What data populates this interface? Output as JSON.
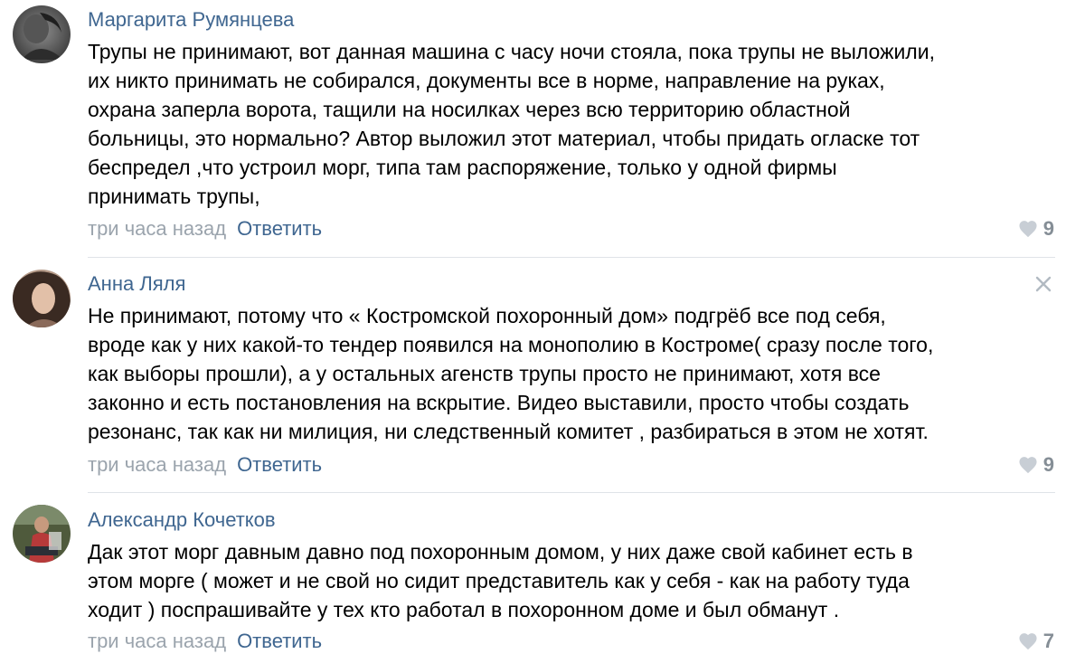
{
  "comments": [
    {
      "author": "Маргарита Румянцева",
      "lines": [
        "Трупы не принимают, вот данная машина с часу ночи стояла, пока трупы не выложили,",
        "их никто принимать не собирался, документы все в норме, направление на руках,",
        "охрана заперла ворота, тащили на носилках через всю территорию областной",
        "больницы, это нормально? Автор выложил этот материал, чтобы придать огласке тот",
        "беспредел ,что устроил морг, типа там распоряжение, только у одной фирмы",
        "принимать трупы,"
      ],
      "time": "три часа назад",
      "reply_label": "Ответить",
      "likes": "9",
      "avatar_icon": "user-avatar-photo"
    },
    {
      "author": "Анна Ляля",
      "lines": [
        "Не принимают, потому что « Костромской похоронный дом» подгрёб все под себя,",
        "вроде как у них какой-то тендер появился на монополию в Костроме( сразу после того,",
        "как выборы прошли), а у остальных агенств трупы просто не принимают, хотя все",
        "законно и есть постановления на вскрытие. Видео выставили, просто чтобы создать",
        "резонанс, так как ни милиция, ни следственный комитет , разбираться в этом не хотят."
      ],
      "time": "три часа назад",
      "reply_label": "Ответить",
      "likes": "9",
      "avatar_icon": "user-avatar-photo",
      "close_icon": "close-icon"
    },
    {
      "author": "Александр Кочетков",
      "lines": [
        "Дак этот морг давным давно под похоронным домом, у них даже свой кабинет есть в",
        "этом морге ( может и не свой но сидит представитель как у себя - как на работу туда",
        "ходит ) поспрашивайте у тех кто работал в похоронном доме и был обманут ."
      ],
      "time": "три часа назад",
      "reply_label": "Ответить",
      "likes": "7",
      "avatar_icon": "user-avatar-photo"
    }
  ],
  "colors": {
    "author": "#3f6690",
    "reply": "#3f6690",
    "time": "#9ba4ad",
    "likes": "#858e96",
    "divider": "#dfe3e8"
  }
}
